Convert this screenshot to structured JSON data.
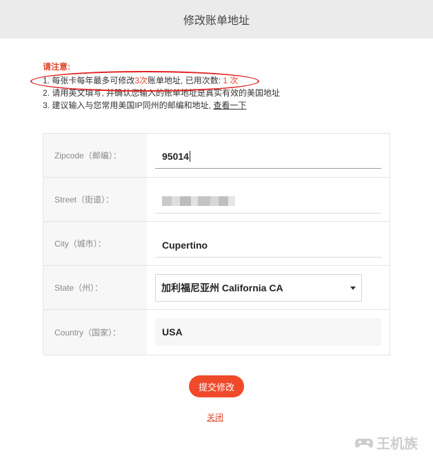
{
  "header": {
    "title": "修改账单地址"
  },
  "notice": {
    "title": "请注意:",
    "line1_prefix": "1. 每张卡每年最多可修改",
    "line1_limit": "3次",
    "line1_middle": "账单地址, 已用次数: ",
    "line1_used": "1 次",
    "line2": "2. 请用英文填写, 并确认您输入的账单地址是真实有效的美国地址",
    "line3_prefix": "3. 建议输入与您常用美国IP同州的邮编和地址, ",
    "line3_link": "查看一下"
  },
  "form": {
    "zipcode": {
      "label": "Zipcode（邮编）：",
      "value": "95014"
    },
    "street": {
      "label": "Street（街道）：",
      "value": ""
    },
    "city": {
      "label": "City（城市）：",
      "value": "Cupertino"
    },
    "state": {
      "label": "State（州）：",
      "value": "加利福尼亚州 California CA"
    },
    "country": {
      "label": "Country（国家）：",
      "value": "USA"
    }
  },
  "actions": {
    "submit_label": "提交修改",
    "close_label": "关闭"
  },
  "watermark": {
    "text": "王机族"
  },
  "colors": {
    "accent": "#f04a2b",
    "header_bg": "#ebebeb",
    "highlight_ring": "#e02020"
  }
}
